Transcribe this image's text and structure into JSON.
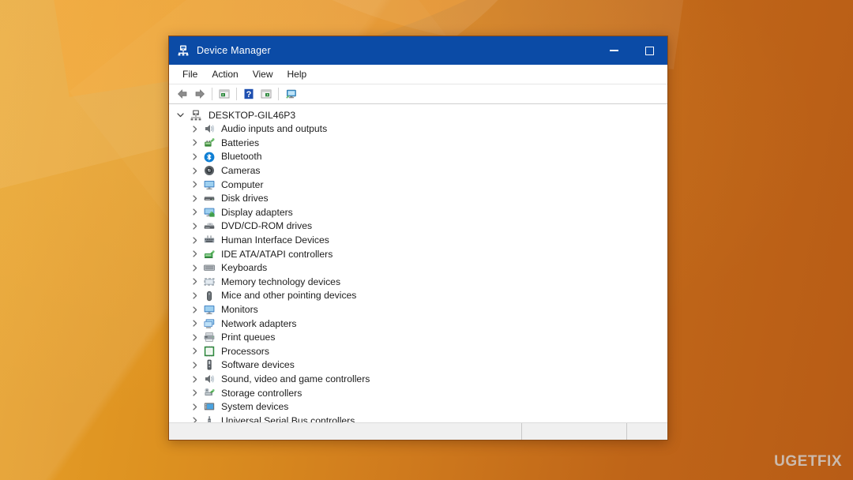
{
  "desktop": {
    "background_colors": [
      "#e8a22a",
      "#cf7a1d",
      "#b85c16"
    ],
    "watermark": "UGETFIX"
  },
  "window": {
    "title": "Device Manager",
    "title_icon": "device-manager-icon",
    "titlebar_color": "#0b4ba6",
    "caption_buttons": [
      {
        "name": "minimize",
        "label": "─"
      },
      {
        "name": "maximize",
        "label": "☐"
      }
    ],
    "menubar": [
      {
        "label": "File"
      },
      {
        "label": "Action"
      },
      {
        "label": "View"
      },
      {
        "label": "Help"
      }
    ],
    "toolbar": [
      {
        "name": "back-icon"
      },
      {
        "name": "forward-icon"
      },
      {
        "name": "separator"
      },
      {
        "name": "properties-icon"
      },
      {
        "name": "separator"
      },
      {
        "name": "help-icon"
      },
      {
        "name": "update-driver-icon"
      },
      {
        "name": "separator"
      },
      {
        "name": "scan-hardware-icon"
      }
    ],
    "statusbar": {
      "panes": [
        "",
        "",
        ""
      ]
    }
  },
  "tree": {
    "root": {
      "label": "DESKTOP-GIL46P3",
      "icon": "computer-root-icon",
      "expanded": true
    },
    "items": [
      {
        "label": "Audio inputs and outputs",
        "icon": "speaker-icon"
      },
      {
        "label": "Batteries",
        "icon": "battery-icon"
      },
      {
        "label": "Bluetooth",
        "icon": "bluetooth-icon"
      },
      {
        "label": "Cameras",
        "icon": "camera-icon"
      },
      {
        "label": "Computer",
        "icon": "monitor-icon"
      },
      {
        "label": "Disk drives",
        "icon": "disk-drive-icon"
      },
      {
        "label": "Display adapters",
        "icon": "display-adapter-icon"
      },
      {
        "label": "DVD/CD-ROM drives",
        "icon": "dvd-drive-icon"
      },
      {
        "label": "Human Interface Devices",
        "icon": "hid-icon"
      },
      {
        "label": "IDE ATA/ATAPI controllers",
        "icon": "ide-controller-icon"
      },
      {
        "label": "Keyboards",
        "icon": "keyboard-icon"
      },
      {
        "label": "Memory technology devices",
        "icon": "memory-icon"
      },
      {
        "label": "Mice and other pointing devices",
        "icon": "mouse-icon"
      },
      {
        "label": "Monitors",
        "icon": "monitor-icon"
      },
      {
        "label": "Network adapters",
        "icon": "network-adapter-icon"
      },
      {
        "label": "Print queues",
        "icon": "printer-icon"
      },
      {
        "label": "Processors",
        "icon": "processor-icon"
      },
      {
        "label": "Software devices",
        "icon": "software-device-icon"
      },
      {
        "label": "Sound, video and game controllers",
        "icon": "speaker-icon"
      },
      {
        "label": "Storage controllers",
        "icon": "storage-controller-icon"
      },
      {
        "label": "System devices",
        "icon": "system-device-icon"
      },
      {
        "label": "Universal Serial Bus controllers",
        "icon": "usb-icon"
      }
    ]
  }
}
